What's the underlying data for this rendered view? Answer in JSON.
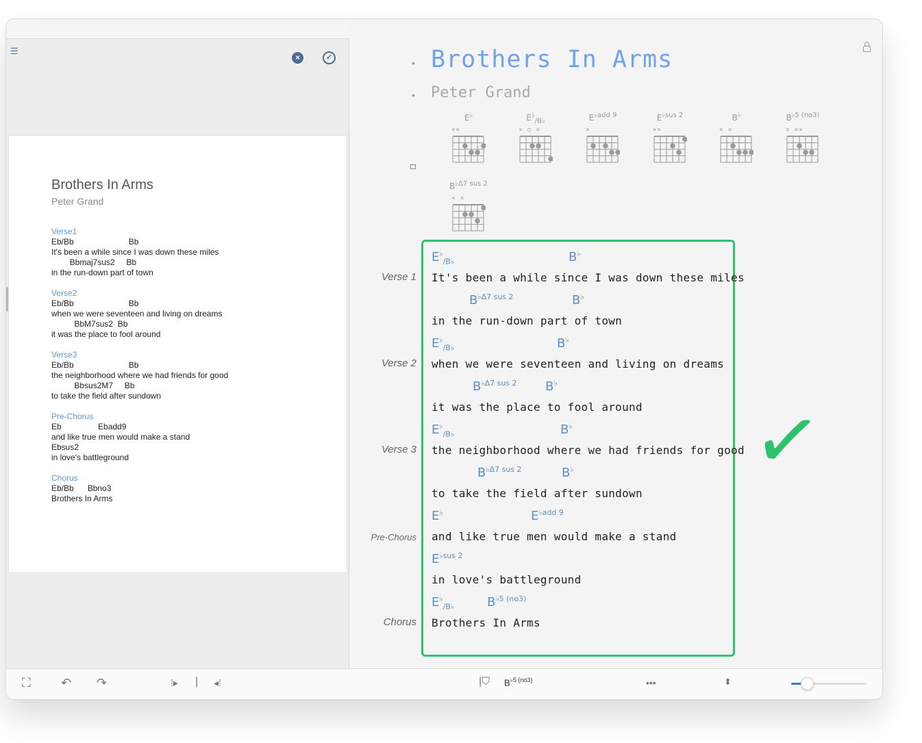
{
  "song": {
    "title": "Brothers In Arms",
    "artist": "Peter Grand"
  },
  "pdf_preview": {
    "title": "Brothers In Arms",
    "artist": "Peter Grand",
    "lines": [
      {
        "type": "section",
        "text": "Verse1"
      },
      {
        "type": "line",
        "text": "Eb/Bb                        Bb"
      },
      {
        "type": "line",
        "text": "It's been a while since I was down these miles"
      },
      {
        "type": "line",
        "text": "        Bbmaj7sus2     Bb"
      },
      {
        "type": "line",
        "text": "in the run-down part of town"
      },
      {
        "type": "gap"
      },
      {
        "type": "section",
        "text": "Verse2"
      },
      {
        "type": "line",
        "text": "Eb/Bb                        Bb"
      },
      {
        "type": "line",
        "text": "when we were seventeen and living on dreams"
      },
      {
        "type": "line",
        "text": "          BbM7sus2  Bb"
      },
      {
        "type": "line",
        "text": "it was the place to fool around"
      },
      {
        "type": "gap"
      },
      {
        "type": "section",
        "text": "Verse3"
      },
      {
        "type": "line",
        "text": "Eb/Bb                        Bb"
      },
      {
        "type": "line",
        "text": "the neighborhood where we had friends for good"
      },
      {
        "type": "line",
        "text": "          Bbsus2M7     Bb"
      },
      {
        "type": "line",
        "text": "to take the field after sundown"
      },
      {
        "type": "gap"
      },
      {
        "type": "section",
        "text": "Pre-Chorus"
      },
      {
        "type": "line",
        "text": "Eb                Ebadd9"
      },
      {
        "type": "line",
        "text": "and like true men would make a stand"
      },
      {
        "type": "line",
        "text": "Ebsus2"
      },
      {
        "type": "line",
        "text": "in love's battleground"
      },
      {
        "type": "gap"
      },
      {
        "type": "section",
        "text": "Chorus"
      },
      {
        "type": "line",
        "text": "Eb/Bb      Bbno3"
      },
      {
        "type": "line",
        "text": "Brothers In Arms"
      }
    ]
  },
  "chord_diagrams": [
    {
      "root": "E",
      "acc": "♭",
      "ext": "",
      "bass": "",
      "mutes": "××"
    },
    {
      "root": "E",
      "acc": "♭",
      "ext": "",
      "bass": "B♭",
      "mutes": "×  ○ ×"
    },
    {
      "root": "E",
      "acc": "♭",
      "ext": "add 9",
      "bass": "",
      "mutes": "×"
    },
    {
      "root": "E",
      "acc": "♭",
      "ext": "sus 2",
      "bass": "",
      "mutes": "××"
    },
    {
      "root": "B",
      "acc": "♭",
      "ext": "",
      "bass": "",
      "mutes": "×       ×"
    },
    {
      "root": "B",
      "acc": "♭",
      "ext": "5 (no3)",
      "bass": "",
      "mutes": "×     ××"
    },
    {
      "root": "B",
      "acc": "♭",
      "ext": "Δ7 sus 2",
      "bass": "",
      "mutes": "×       ×"
    }
  ],
  "sections": [
    {
      "label": "Verse 1",
      "lines": [
        {
          "chords": [
            {
              "root": "E",
              "acc": "♭",
              "ext": "",
              "bass": "B♭"
            },
            {
              "root": "B",
              "acc": "♭",
              "ext": "",
              "bass": ""
            }
          ],
          "lyric": "It's been a while since I was down these miles"
        },
        {
          "chords": [
            {
              "root": "B",
              "acc": "♭",
              "ext": "Δ7 sus 2",
              "bass": ""
            },
            {
              "root": "B",
              "acc": "♭",
              "ext": "",
              "bass": ""
            }
          ],
          "lyric": "in the run-down part of town"
        }
      ]
    },
    {
      "label": "Verse 2",
      "lines": [
        {
          "chords": [
            {
              "root": "E",
              "acc": "♭",
              "ext": "",
              "bass": "B♭"
            },
            {
              "root": "B",
              "acc": "♭",
              "ext": "",
              "bass": ""
            }
          ],
          "lyric": "when we were seventeen and living on dreams"
        },
        {
          "chords": [
            {
              "root": "B",
              "acc": "♭",
              "ext": "Δ7 sus 2",
              "bass": ""
            },
            {
              "root": "B",
              "acc": "♭",
              "ext": "",
              "bass": ""
            }
          ],
          "lyric": "it was the place to fool around"
        }
      ]
    },
    {
      "label": "Verse 3",
      "lines": [
        {
          "chords": [
            {
              "root": "E",
              "acc": "♭",
              "ext": "",
              "bass": "B♭"
            },
            {
              "root": "B",
              "acc": "♭",
              "ext": "",
              "bass": ""
            }
          ],
          "lyric": "the neighborhood where we had friends for good"
        },
        {
          "chords": [
            {
              "root": "B",
              "acc": "♭",
              "ext": "Δ7 sus 2",
              "bass": ""
            },
            {
              "root": "B",
              "acc": "♭",
              "ext": "",
              "bass": ""
            }
          ],
          "lyric": "to take the field after sundown"
        }
      ]
    },
    {
      "label": "Pre-Chorus",
      "lines": [
        {
          "chords": [
            {
              "root": "E",
              "acc": "♭",
              "ext": "",
              "bass": ""
            },
            {
              "root": "E",
              "acc": "♭",
              "ext": "add 9",
              "bass": ""
            }
          ],
          "lyric": "and like true men would make a stand"
        },
        {
          "chords": [
            {
              "root": "E",
              "acc": "♭",
              "ext": "sus 2",
              "bass": ""
            }
          ],
          "lyric": "in love's battleground"
        }
      ]
    },
    {
      "label": "Chorus",
      "lines": [
        {
          "chords": [
            {
              "root": "E",
              "acc": "♭",
              "ext": "",
              "bass": "B♭"
            },
            {
              "root": "B",
              "acc": "♭",
              "ext": "5 (no3)",
              "bass": ""
            }
          ],
          "lyric": "Brothers In Arms"
        }
      ]
    }
  ],
  "toolbar": {
    "current_chord": {
      "root": "B",
      "acc": "♭",
      "ext": "5 (no3)"
    },
    "zoom_level": 0.2
  },
  "colors": {
    "accent": "#6fa3ef",
    "chord": "#5b8fc5",
    "check": "#2dc26b"
  },
  "icons": [
    "menu-icon",
    "close-circle-icon",
    "checkmark-circle-icon",
    "lock-icon",
    "fit-page-icon",
    "undo-icon",
    "redo-icon",
    "step-forward-icon",
    "cursor-icon",
    "step-back-icon",
    "guitar-pick-icon",
    "more-icon",
    "sort-icon"
  ]
}
